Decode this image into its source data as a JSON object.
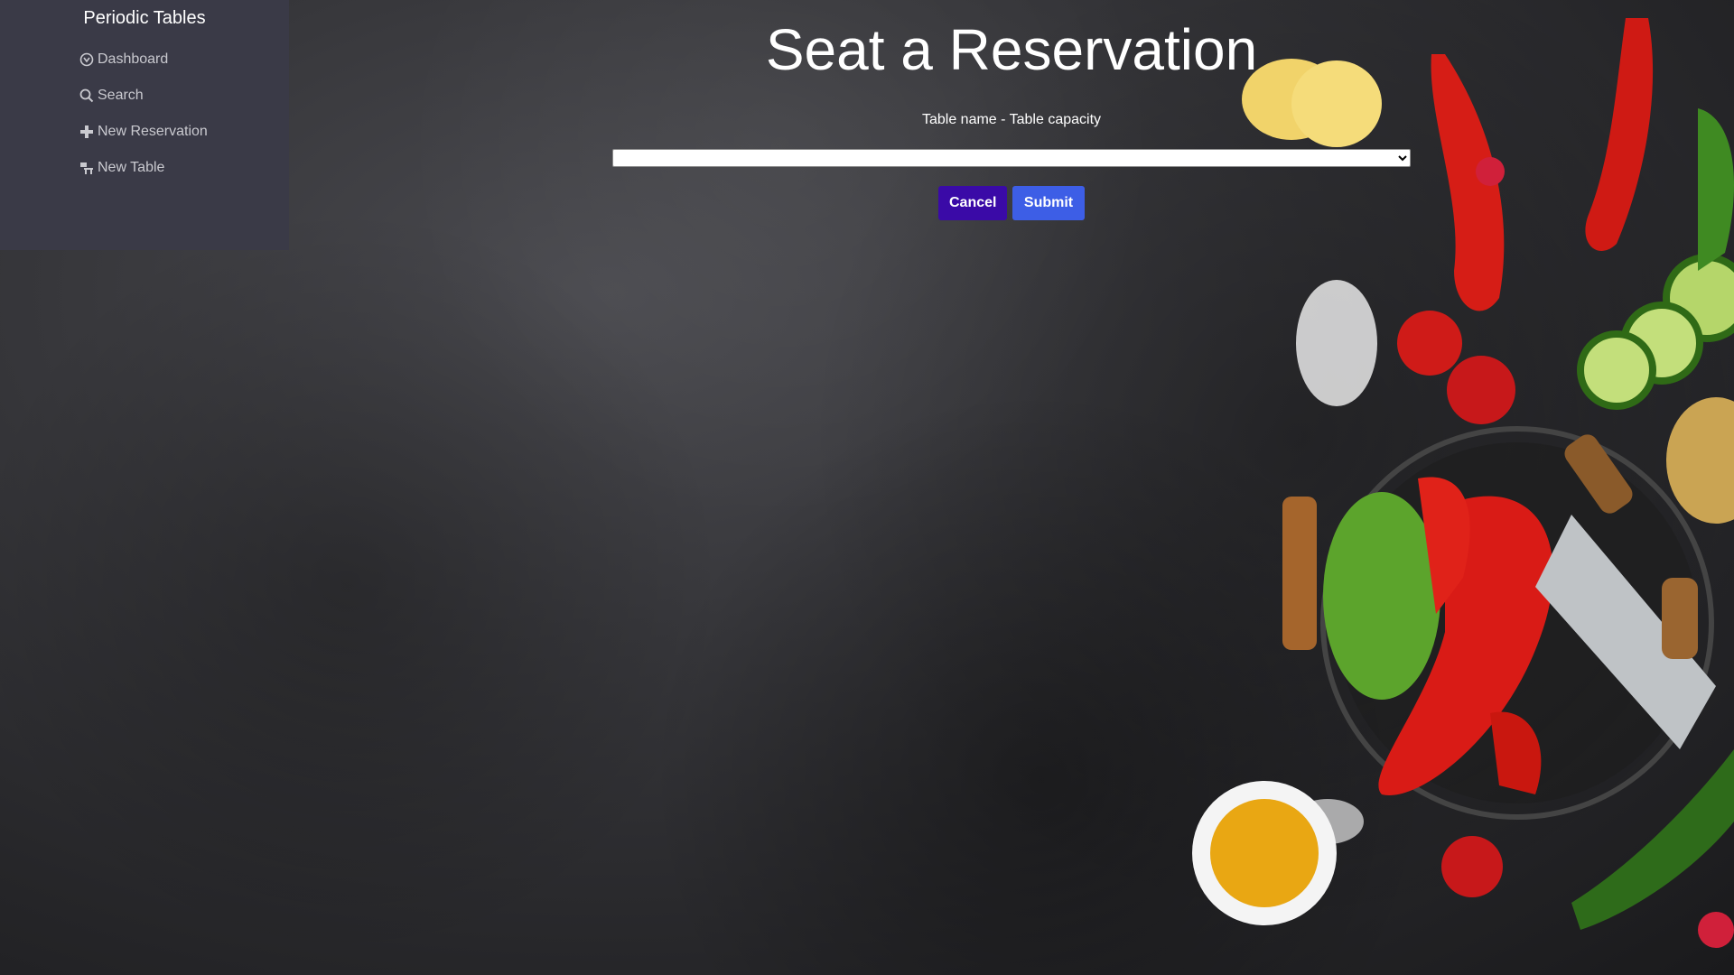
{
  "sidebar": {
    "brand": "Periodic Tables",
    "items": [
      {
        "label": "Dashboard",
        "icon": "dashboard-icon"
      },
      {
        "label": "Search",
        "icon": "search-icon"
      },
      {
        "label": "New Reservation",
        "icon": "plus-icon"
      },
      {
        "label": "New Table",
        "icon": "table-icon"
      }
    ]
  },
  "main": {
    "title": "Seat a Reservation",
    "table_select_label": "Table name - Table capacity",
    "table_select_value": "",
    "cancel_label": "Cancel",
    "submit_label": "Submit"
  },
  "colors": {
    "sidebar_bg": "#3a3a47",
    "cancel_bg": "#3a0aa7",
    "submit_bg": "#3d5ee6"
  }
}
